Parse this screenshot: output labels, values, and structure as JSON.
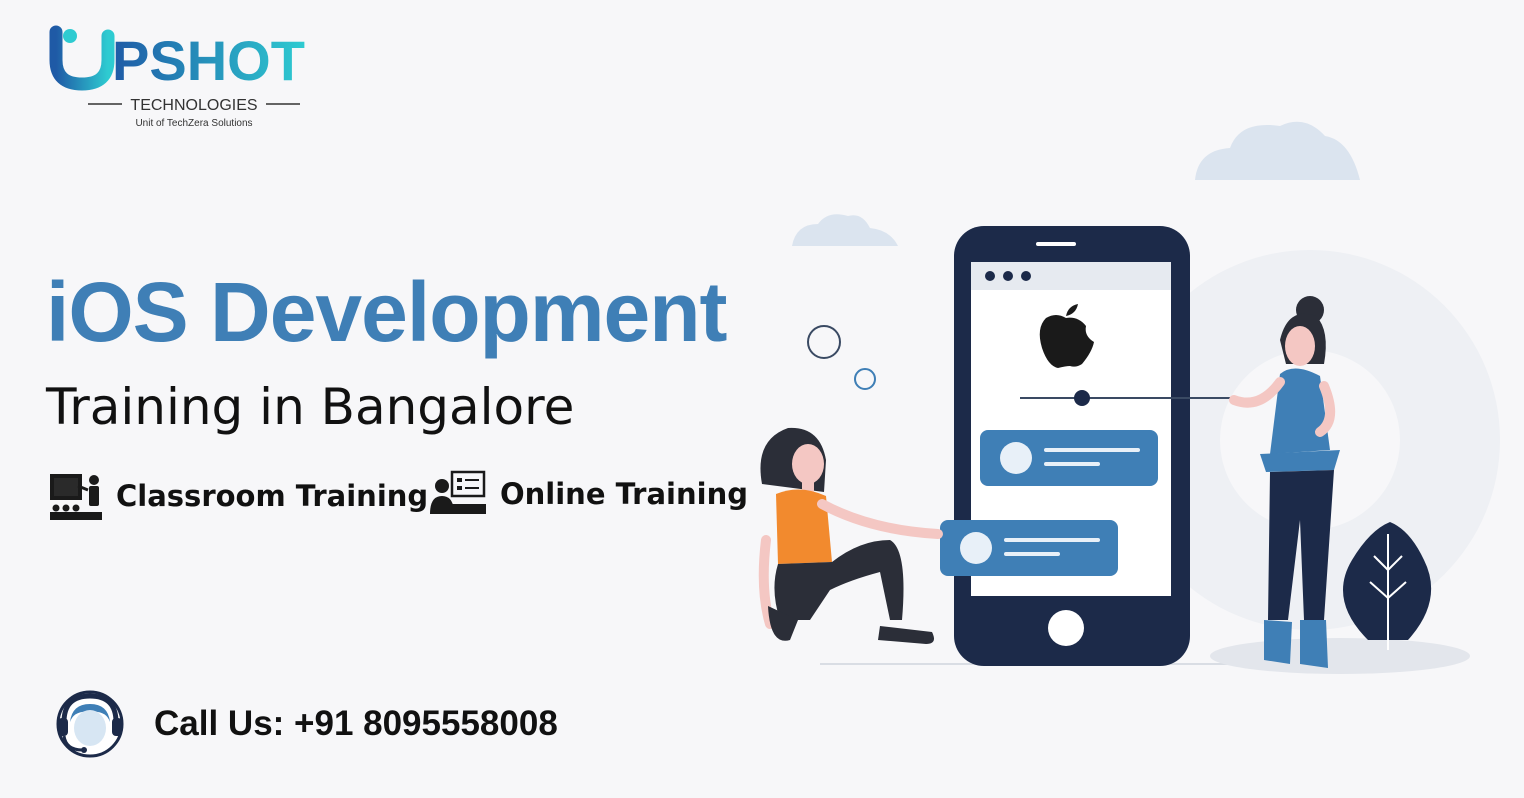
{
  "brand": {
    "logo_text": "PSHOT",
    "subtitle": "TECHNOLOGIES",
    "tagline": "Unit of TechZera Solutions",
    "colors": {
      "primary": "#3f7fb6",
      "logo_gradient_start": "#1f5aa6",
      "logo_gradient_end": "#2ecbd1",
      "dark": "#1c2a49"
    }
  },
  "hero": {
    "title": "iOS Development",
    "subtitle": "Training in Bangalore"
  },
  "modes": [
    {
      "label": "Classroom Training",
      "icon": "classroom-icon"
    },
    {
      "label": "Online Training",
      "icon": "online-training-icon"
    }
  ],
  "contact": {
    "label": "Call Us: +91 8095558008",
    "icon": "support-headset-icon"
  }
}
